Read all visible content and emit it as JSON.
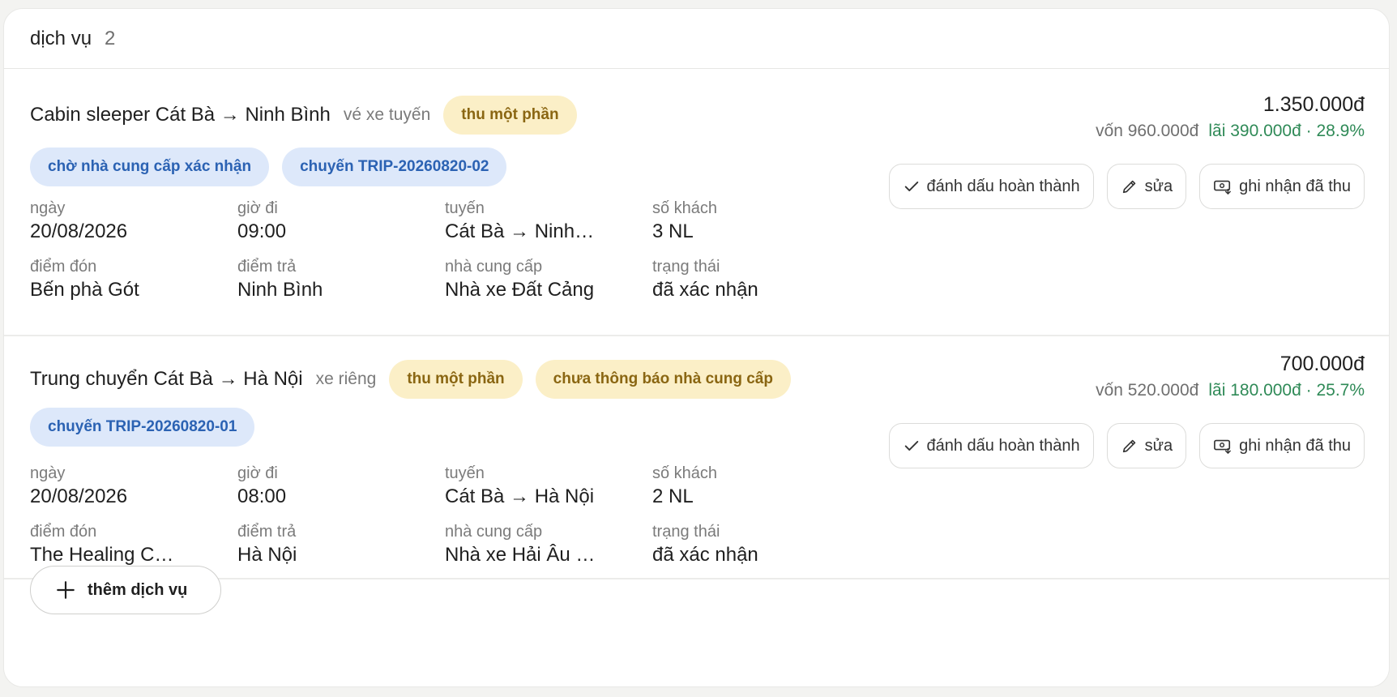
{
  "header": {
    "title": "dịch vụ",
    "count": "2"
  },
  "labels": {
    "date": "ngày",
    "depart_time": "giờ đi",
    "route": "tuyến",
    "passengers": "số khách",
    "pickup": "điểm đón",
    "dropoff": "điểm trả",
    "provider": "nhà cung cấp",
    "status": "trạng thái"
  },
  "actions": {
    "complete": "đánh dấu hoàn thành",
    "edit": "sửa",
    "record_payment": "ghi nhận đã thu"
  },
  "services": [
    {
      "name": "Cabin sleeper Cát Bà → Ninh Bình",
      "type": "vé xe tuyến",
      "badges_yellow": [
        "thu một phần"
      ],
      "badges_blue": [
        "chờ nhà cung cấp xác nhận",
        "chuyến TRIP-20260820-02"
      ],
      "price": "1.350.000đ",
      "cost": "vốn 960.000đ",
      "profit": "lãi 390.000đ · 28.9%",
      "date": "20/08/2026",
      "depart_time": "09:00",
      "route": "Cát Bà → Ninh Bình",
      "passengers": "3 NL",
      "pickup": "Bến phà Gót",
      "dropoff": "Ninh Bình",
      "provider": "Nhà xe Đất Cảng",
      "status": "đã xác nhận"
    },
    {
      "name": "Trung chuyển Cát Bà → Hà Nội",
      "type": "xe riêng",
      "badges_yellow": [
        "thu một phần",
        "chưa thông báo nhà cung cấp"
      ],
      "badges_blue": [
        "chuyến TRIP-20260820-01"
      ],
      "price": "700.000đ",
      "cost": "vốn 520.000đ",
      "profit": "lãi 180.000đ · 25.7%",
      "date": "20/08/2026",
      "depart_time": "08:00",
      "route": "Cát Bà → Hà Nội",
      "passengers": "2 NL",
      "pickup": "The Healing Cat Ba",
      "dropoff": "Hà Nội",
      "provider": "Nhà xe Hải Âu Limousine",
      "status": "đã xác nhận"
    }
  ],
  "add_service": "thêm dịch vụ",
  "colors": {
    "badge_yellow_bg": "#fbefc7",
    "badge_yellow_text": "#8a6612",
    "badge_blue_bg": "#dde8fa",
    "badge_blue_text": "#2b62b3",
    "profit": "#2f8a57"
  }
}
